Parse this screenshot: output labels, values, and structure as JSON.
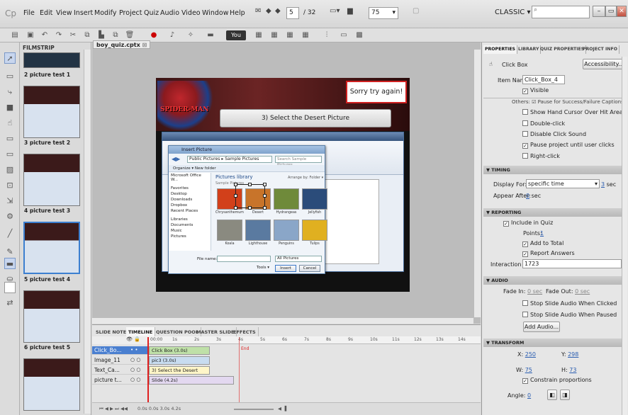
{
  "menubar": {
    "items": [
      "File",
      "Edit",
      "View",
      "Insert",
      "Modify",
      "Project",
      "Quiz",
      "Audio",
      "Video",
      "Window",
      "Help"
    ],
    "slide_number": "5",
    "slide_total": "32",
    "zoom": "75",
    "workspace": "CLASSIC"
  },
  "toolbar": {
    "youtube_label": "You Tube"
  },
  "filmstrip": {
    "title": "FILMSTRIP",
    "slides": [
      {
        "label": "2 picture test 1"
      },
      {
        "label": "3 picture test 2"
      },
      {
        "label": "4 picture test 3"
      },
      {
        "label": "5 picture test 4"
      },
      {
        "label": "6 picture test 5"
      }
    ]
  },
  "document": {
    "tab_name": "boy_quiz.cptx"
  },
  "stage": {
    "sorry_text": "Sorry try again!",
    "question_text": "3) Select the Desert Picture",
    "logo_text": "SPIDER-MAN",
    "dialog": {
      "title": "Insert Picture",
      "address": "Public Pictures ▸ Sample Pictures",
      "search_placeholder": "Search Sample Pictures",
      "organize": "Organize ▾   New folder",
      "nav_items": [
        "Microsoft Office W...",
        "Favorites",
        "Desktop",
        "Downloads",
        "Dropbox",
        "Recent Places",
        "Libraries",
        "Documents",
        "Music",
        "Pictures"
      ],
      "library_title": "Pictures library",
      "library_subtitle": "Sample Pictures",
      "arrange": "Arrange by:  Folder ▾",
      "pictures": [
        {
          "name": "Chrysanthemum",
          "color": "#d2401a"
        },
        {
          "name": "Desert",
          "color": "#c8742a"
        },
        {
          "name": "Hydrangeas",
          "color": "#6f8a3a"
        },
        {
          "name": "Jellyfish",
          "color": "#2b4c7a"
        },
        {
          "name": "Koala",
          "color": "#8a8a80"
        },
        {
          "name": "Lighthouse",
          "color": "#5a7aa0"
        },
        {
          "name": "Penguins",
          "color": "#8aa6c8"
        },
        {
          "name": "Tulips",
          "color": "#e0b020"
        }
      ],
      "file_name_label": "File name:",
      "file_type": "All Pictures",
      "tools_label": "Tools ▾",
      "insert_label": "Insert",
      "cancel_label": "Cancel"
    }
  },
  "timeline": {
    "tabs": [
      "SLIDE NOTES",
      "TIMELINE",
      "QUESTION POOL",
      "MASTER SLIDE",
      "EFFECTS"
    ],
    "active_tab": "TIMELINE",
    "ruler_ticks": [
      "00:00",
      "1s",
      "2s",
      "3s",
      "4s",
      "5s",
      "6s",
      "7s",
      "8s",
      "9s",
      "10s",
      "11s",
      "12s",
      "13s",
      "14s"
    ],
    "end_label": "End",
    "layers": [
      {
        "name": "Click_Bo...",
        "track": "Click Box (3.0s)",
        "track_color": "#bfe0a8"
      },
      {
        "name": "Image_11",
        "track": "pic3 (3.0s)",
        "track_color": "#c8dcf0"
      },
      {
        "name": "Text_Ca...",
        "track": "3) Select the Desert Picture ...",
        "track_color": "#fff6c8"
      },
      {
        "name": "picture t...",
        "track": "Slide (4.2s)",
        "track_color": "#e3d8f0"
      }
    ],
    "footer": "0.0s   0.0s   3.0s   4.2s"
  },
  "properties": {
    "tabs": [
      "PROPERTIES",
      "LIBRARY",
      "QUIZ PROPERTIES",
      "PROJECT INFO"
    ],
    "object_type": "Click Box",
    "accessibility_label": "Accessibility...",
    "item_name_label": "Item Name:",
    "item_name": "Click_Box_4",
    "visible_label": "Visible",
    "others_label": "Others: ☑ Pause for Success/Failure Captions",
    "options": [
      {
        "label": "Show Hand Cursor Over Hit Area",
        "checked": false
      },
      {
        "label": "Double-click",
        "checked": false
      },
      {
        "label": "Disable Click Sound",
        "checked": false
      },
      {
        "label": "Pause project until user clicks",
        "checked": true
      },
      {
        "label": "Right-click",
        "checked": false
      }
    ],
    "timing": {
      "header": "TIMING",
      "display_for_label": "Display For:",
      "display_for": "specific time",
      "duration": "3",
      "duration_unit": "sec",
      "appear_after_label": "Appear After:",
      "appear_after": "0",
      "appear_unit": "sec"
    },
    "reporting": {
      "header": "REPORTING",
      "include_label": "Include in Quiz",
      "points_label": "Points:",
      "points": "1",
      "add_total_label": "Add to Total",
      "report_answers_label": "Report Answers",
      "interaction_label": "Interaction ID:",
      "interaction_id": "1723"
    },
    "audio": {
      "header": "AUDIO",
      "fade_in_label": "Fade In:",
      "fade_in": "0 sec",
      "fade_out_label": "Fade Out:",
      "fade_out": "0 sec",
      "stop_clicked_label": "Stop Slide Audio When Clicked",
      "stop_paused_label": "Stop Slide Audio When Paused",
      "add_audio_label": "Add Audio..."
    },
    "transform": {
      "header": "TRANSFORM",
      "x_label": "X:",
      "x": "250",
      "y_label": "Y:",
      "y": "298",
      "w_label": "W:",
      "w": "75",
      "h_label": "H:",
      "h": "73",
      "constrain_label": "Constrain proportions",
      "angle_label": "Angle:",
      "angle": "0"
    }
  }
}
